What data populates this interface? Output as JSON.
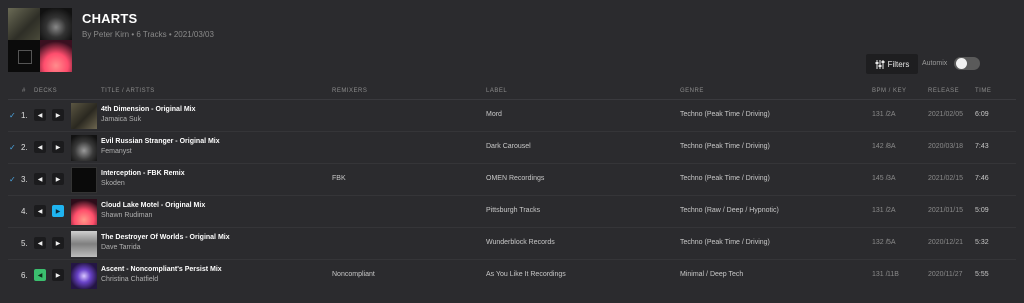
{
  "header": {
    "title": "CHARTS",
    "meta": "By Peter Kirn • 6 Tracks • 2021/03/03"
  },
  "controls": {
    "filters_label": "Filters",
    "automix_label": "Automix",
    "automix_on": false
  },
  "columns": {
    "num": "#",
    "decks": "DECKS",
    "title": "TITLE / ARTISTS",
    "remixers": "REMIXERS",
    "label": "LABEL",
    "genre": "GENRE",
    "bpm_key": "BPM / KEY",
    "release": "RELEASE",
    "time": "TIME"
  },
  "tracks": [
    {
      "checked": true,
      "num": "1.",
      "title": "4th Dimension - Original Mix",
      "artist": "Jamaica Suk",
      "remixers": "",
      "label": "Mord",
      "genre": "Techno (Peak Time / Driving)",
      "bpm": "131",
      "key": "2A",
      "release": "2021/02/05",
      "time": "6:09"
    },
    {
      "checked": true,
      "num": "2.",
      "title": "Evil Russian Stranger - Original Mix",
      "artist": "Femanyst",
      "remixers": "",
      "label": "Dark Carousel",
      "genre": "Techno (Peak Time / Driving)",
      "bpm": "142",
      "key": "8A",
      "release": "2020/03/18",
      "time": "7:43"
    },
    {
      "checked": true,
      "num": "3.",
      "title": "Interception - FBK Remix",
      "artist": "Skoden",
      "remixers": "FBK",
      "label": "OMEN Recordings",
      "genre": "Techno (Peak Time / Driving)",
      "bpm": "145",
      "key": "3A",
      "release": "2021/02/15",
      "time": "7:46"
    },
    {
      "checked": false,
      "num": "4.",
      "title": "Cloud Lake Motel - Original Mix",
      "artist": "Shawn Rudiman",
      "remixers": "",
      "label": "Pittsburgh Tracks",
      "genre": "Techno (Raw / Deep / Hypnotic)",
      "bpm": "131",
      "key": "2A",
      "release": "2021/01/15",
      "time": "5:09"
    },
    {
      "checked": false,
      "num": "5.",
      "title": "The Destroyer Of Worlds - Original Mix",
      "artist": "Dave Tarrida",
      "remixers": "",
      "label": "Wunderblock Records",
      "genre": "Techno (Peak Time / Driving)",
      "bpm": "132",
      "key": "5A",
      "release": "2020/12/21",
      "time": "5:32"
    },
    {
      "checked": false,
      "num": "6.",
      "title": "Ascent - Noncompliant's Persist Mix",
      "artist": "Christina Chatfield",
      "remixers": "Noncompliant",
      "label": "As You Like It Recordings",
      "genre": "Minimal / Deep Tech",
      "bpm": "131",
      "key": "11B",
      "release": "2020/11/27",
      "time": "5:55"
    }
  ],
  "colors": {
    "accent_check": "#4aa3df",
    "deck_b_active": "#1fb4f0",
    "deck_a_active": "#3bbf6e"
  }
}
